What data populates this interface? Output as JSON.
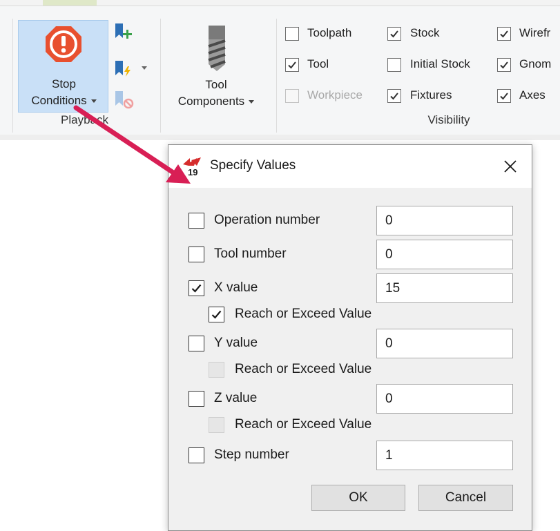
{
  "ribbon": {
    "playback": {
      "stop_conditions_label_1": "Stop",
      "stop_conditions_label_2": "Conditions",
      "group_label": "Playback"
    },
    "tool_components": {
      "label_1": "Tool",
      "label_2": "Components"
    },
    "visibility": {
      "group_label": "Visibility",
      "items": [
        {
          "label": "Toolpath",
          "checked": false,
          "enabled": true
        },
        {
          "label": "Tool",
          "checked": true,
          "enabled": true
        },
        {
          "label": "Workpiece",
          "checked": false,
          "enabled": false
        },
        {
          "label": "Stock",
          "checked": true,
          "enabled": true
        },
        {
          "label": "Initial Stock",
          "checked": false,
          "enabled": true
        },
        {
          "label": "Fixtures",
          "checked": true,
          "enabled": true
        },
        {
          "label": "Wirefr",
          "checked": true,
          "enabled": true
        },
        {
          "label": "Gnom",
          "checked": true,
          "enabled": true
        },
        {
          "label": "Axes",
          "checked": true,
          "enabled": true
        }
      ]
    }
  },
  "dialog": {
    "title": "Specify Values",
    "logo_text": "19",
    "rows": [
      {
        "label": "Operation number",
        "checked": false,
        "value": "0"
      },
      {
        "label": "Tool number",
        "checked": false,
        "value": "0"
      },
      {
        "label": "X value",
        "checked": true,
        "value": "15",
        "sub_label": "Reach or Exceed Value",
        "sub_checked": true,
        "sub_enabled": true
      },
      {
        "label": "Y value",
        "checked": false,
        "value": "0",
        "sub_label": "Reach or Exceed Value",
        "sub_checked": false,
        "sub_enabled": false
      },
      {
        "label": "Z value",
        "checked": false,
        "value": "0",
        "sub_label": "Reach or Exceed Value",
        "sub_checked": false,
        "sub_enabled": false
      },
      {
        "label": "Step number",
        "checked": false,
        "value": "1"
      }
    ],
    "ok_label": "OK",
    "cancel_label": "Cancel"
  },
  "colors": {
    "stop_icon": "#e8502f",
    "stop_button_bg": "#c9e0f7",
    "annotation_arrow": "#d81f55",
    "ribbon_blue_icon": "#2d6fb5"
  }
}
